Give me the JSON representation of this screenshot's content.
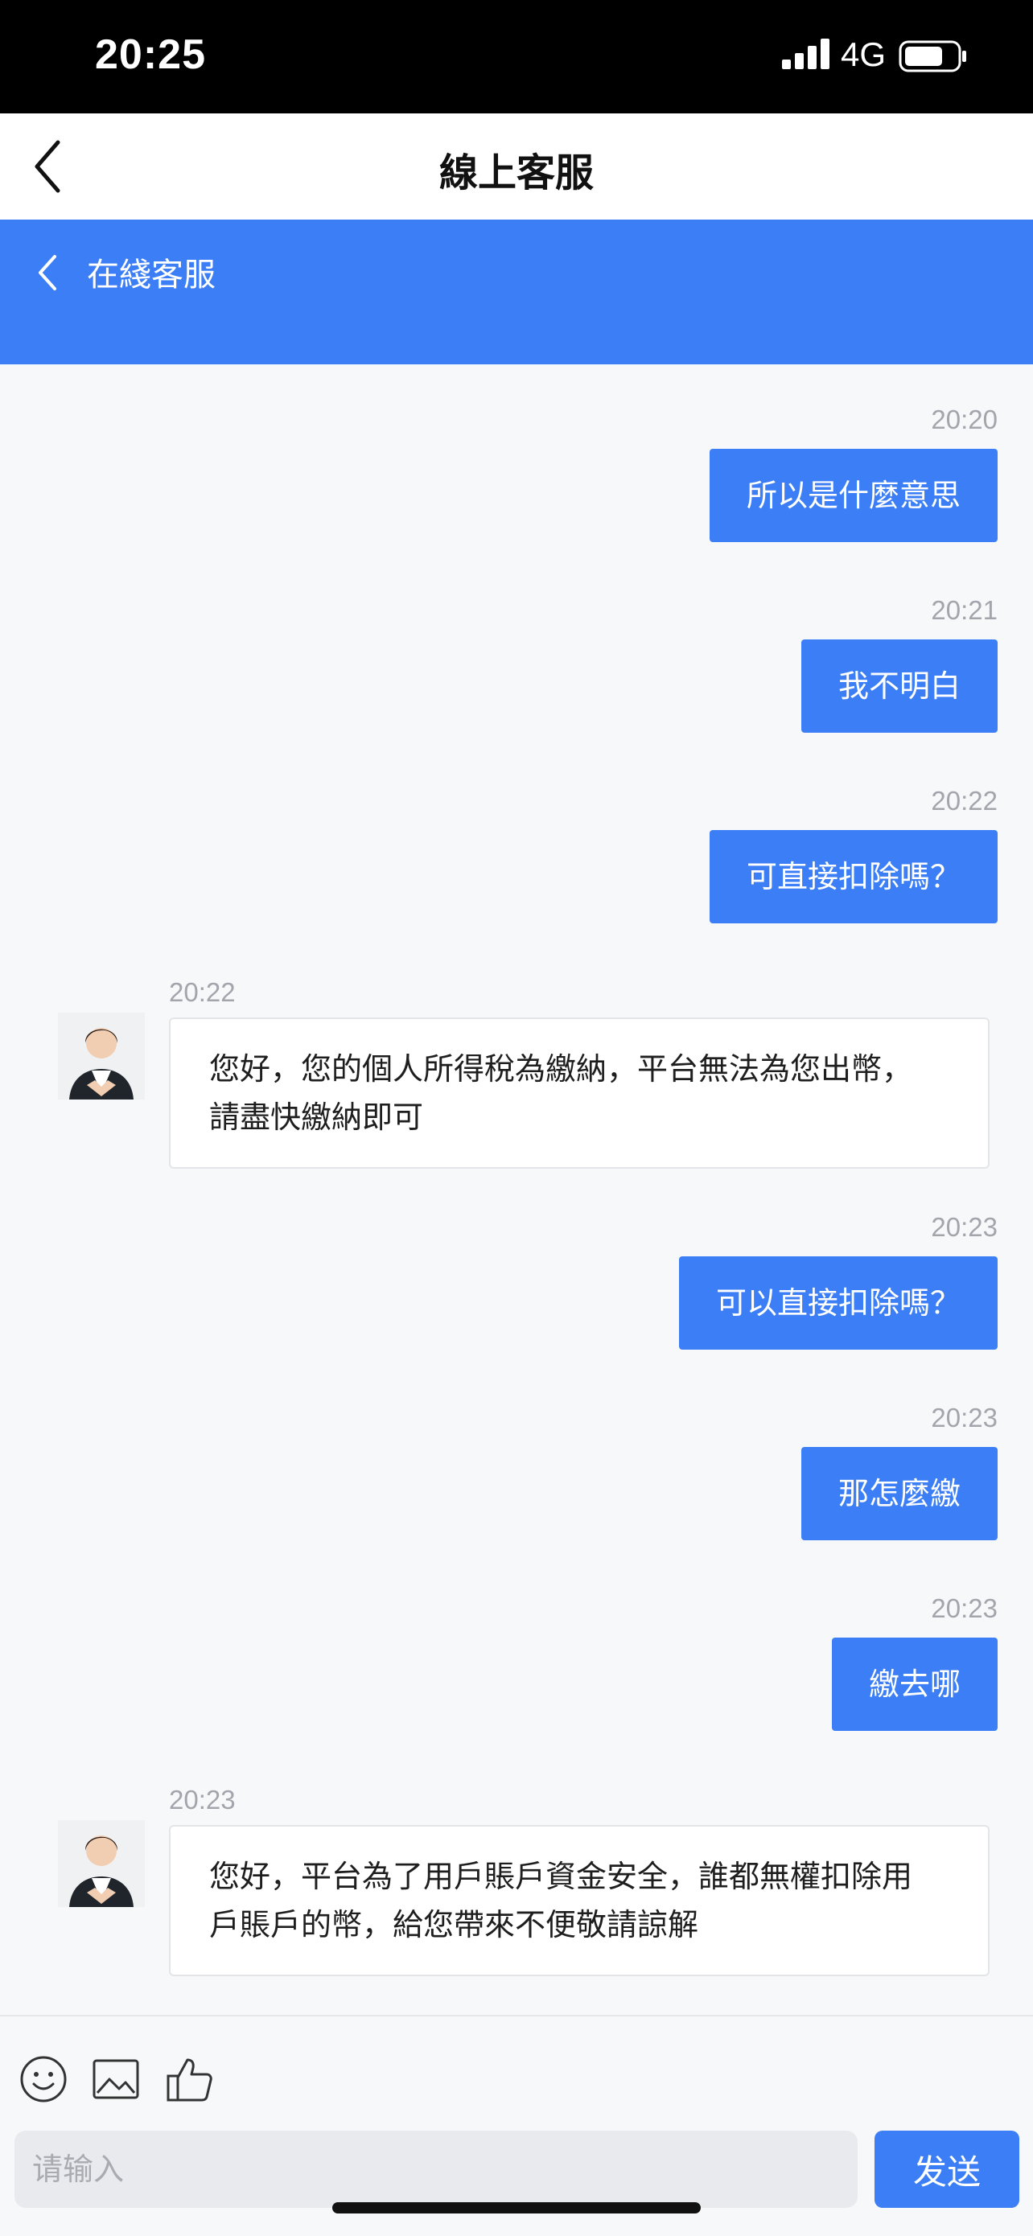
{
  "status_bar": {
    "time": "20:25",
    "network": "4G"
  },
  "nav": {
    "title": "線上客服"
  },
  "chat_header": {
    "title": "在綫客服"
  },
  "messages": [
    {
      "time": "20:20",
      "text": "所以是什麼意思"
    },
    {
      "time": "20:21",
      "text": "我不明白"
    },
    {
      "time": "20:22",
      "text": "可直接扣除嗎？"
    },
    {
      "time": "20:22",
      "line1": "您好，您的個人所得稅為繳納，平台無法為您出幣，",
      "line2": "請盡快繳納即可"
    },
    {
      "time": "20:23",
      "text": "可以直接扣除嗎？"
    },
    {
      "time": "20:23",
      "text": "那怎麼繳"
    },
    {
      "time": "20:23",
      "text": "繳去哪"
    },
    {
      "time": "20:23",
      "line1": "您好，平台為了用戶賬戶資金安全，誰都無權扣除用",
      "line2": "戶賬戶的幣，給您帶來不便敬請諒解"
    }
  ],
  "input": {
    "placeholder": "请输入",
    "send_label": "发送"
  },
  "icons": [
    "signal-icon",
    "battery-icon",
    "back-arrow-icon",
    "emoji-icon",
    "image-icon",
    "thumbs-up-icon"
  ],
  "colors": {
    "accent": "#3b7ef5",
    "background": "#f7f8fa"
  }
}
